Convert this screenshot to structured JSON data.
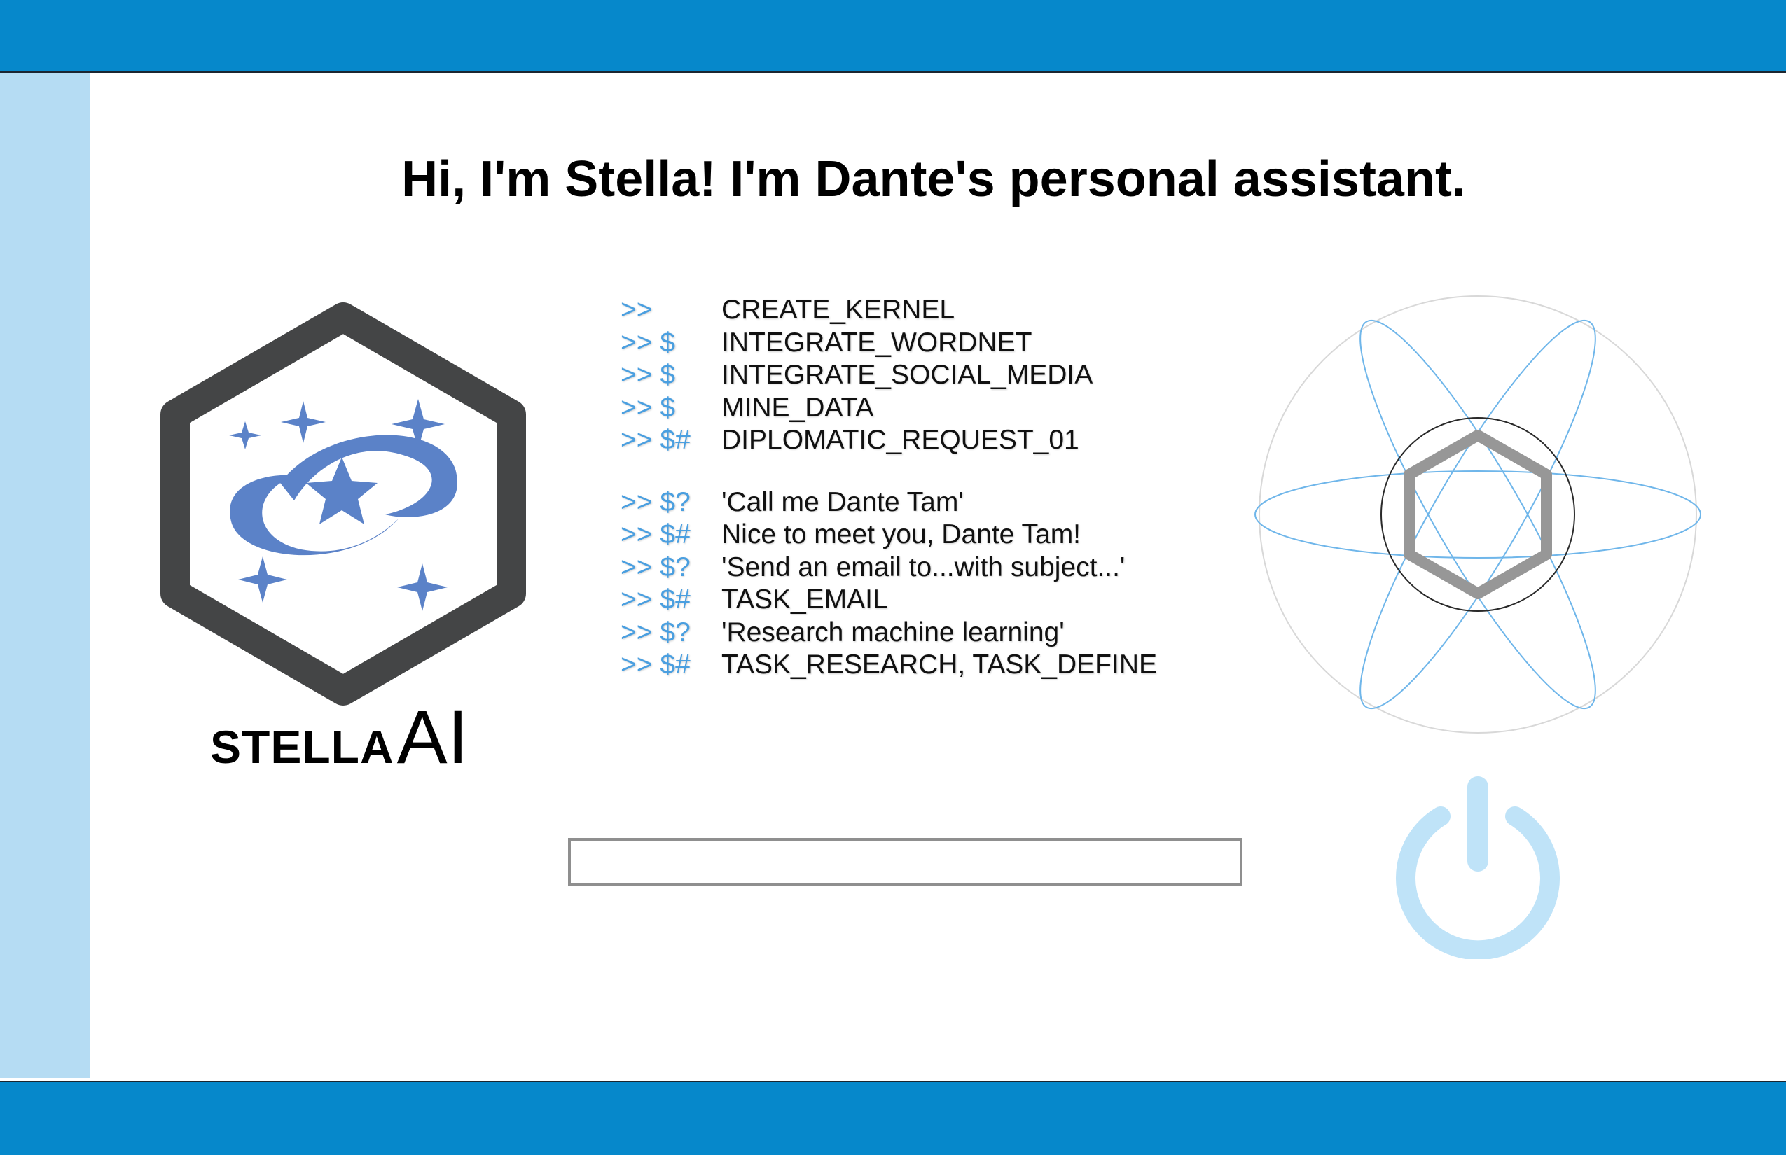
{
  "greeting": "Hi, I'm Stella! I'm Dante's personal assistant.",
  "brand": {
    "name_part1": "STELLA",
    "name_part2": "AI"
  },
  "log": {
    "setup": [
      {
        "prompt": ">>",
        "text": "CREATE_KERNEL"
      },
      {
        "prompt": ">> $",
        "text": "INTEGRATE_WORDNET"
      },
      {
        "prompt": ">> $",
        "text": "INTEGRATE_SOCIAL_MEDIA"
      },
      {
        "prompt": ">> $",
        "text": "MINE_DATA"
      },
      {
        "prompt": ">> $#",
        "text": "DIPLOMATIC_REQUEST_01"
      }
    ],
    "conversation": [
      {
        "prompt": ">> $?",
        "text": "'Call me Dante Tam'"
      },
      {
        "prompt": ">> $#",
        "text": "Nice to meet you, Dante Tam!"
      },
      {
        "prompt": ">> $?",
        "text": "'Send an email to...with subject...'"
      },
      {
        "prompt": ">> $#",
        "text": "TASK_EMAIL"
      },
      {
        "prompt": ">> $?",
        "text": "'Research machine learning'"
      },
      {
        "prompt": ">> $#",
        "text": "TASK_RESEARCH, TASK_DEFINE"
      }
    ]
  },
  "command_input": {
    "value": "",
    "placeholder": ""
  },
  "icons": {
    "logo": "stella-hexagon-logo-icon",
    "atom": "atom-orbit-icon",
    "power": "power-icon"
  },
  "colors": {
    "header_bar": "#0688cb",
    "side_bar": "#b5dcf3",
    "prompt_text": "#4a9fe0",
    "logo_blue": "#5b82c8",
    "logo_hex": "#444546",
    "orbit_line": "#6fb6ea",
    "power_icon": "#bfe3f8",
    "input_border": "#8f8f8f"
  }
}
